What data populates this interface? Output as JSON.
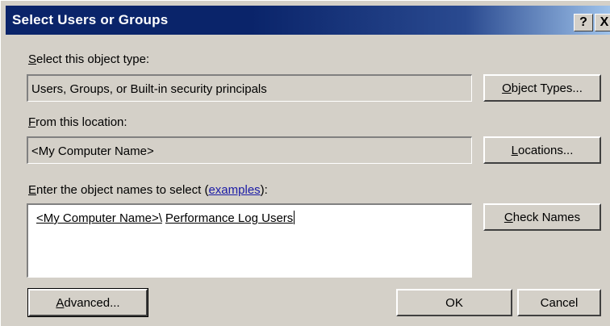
{
  "window": {
    "title": "Select Users or Groups",
    "help_glyph": "?",
    "close_glyph": "X"
  },
  "object_type": {
    "label_accel": "S",
    "label_rest": "elect this object type:",
    "value": "Users, Groups, or Built-in security principals",
    "button_accel": "O",
    "button_rest": "bject Types..."
  },
  "location": {
    "label_accel": "F",
    "label_rest": "rom this location:",
    "value": "<My Computer Name>",
    "button_accel": "L",
    "button_rest": "ocations..."
  },
  "names": {
    "label_accel": "E",
    "label_rest": "nter the object names to select (",
    "label_link": "examples",
    "label_end": "):",
    "value_part1": "<My Computer Name>\\",
    "value_part2": "Performance Log Users",
    "check_accel": "C",
    "check_rest": "heck Names"
  },
  "buttons": {
    "advanced_accel": "A",
    "advanced_rest": "dvanced...",
    "ok": "OK",
    "cancel": "Cancel"
  },
  "colors": {
    "title_bar": "#0a246a",
    "face": "#d4d0c8",
    "link": "#1a1aa6"
  }
}
